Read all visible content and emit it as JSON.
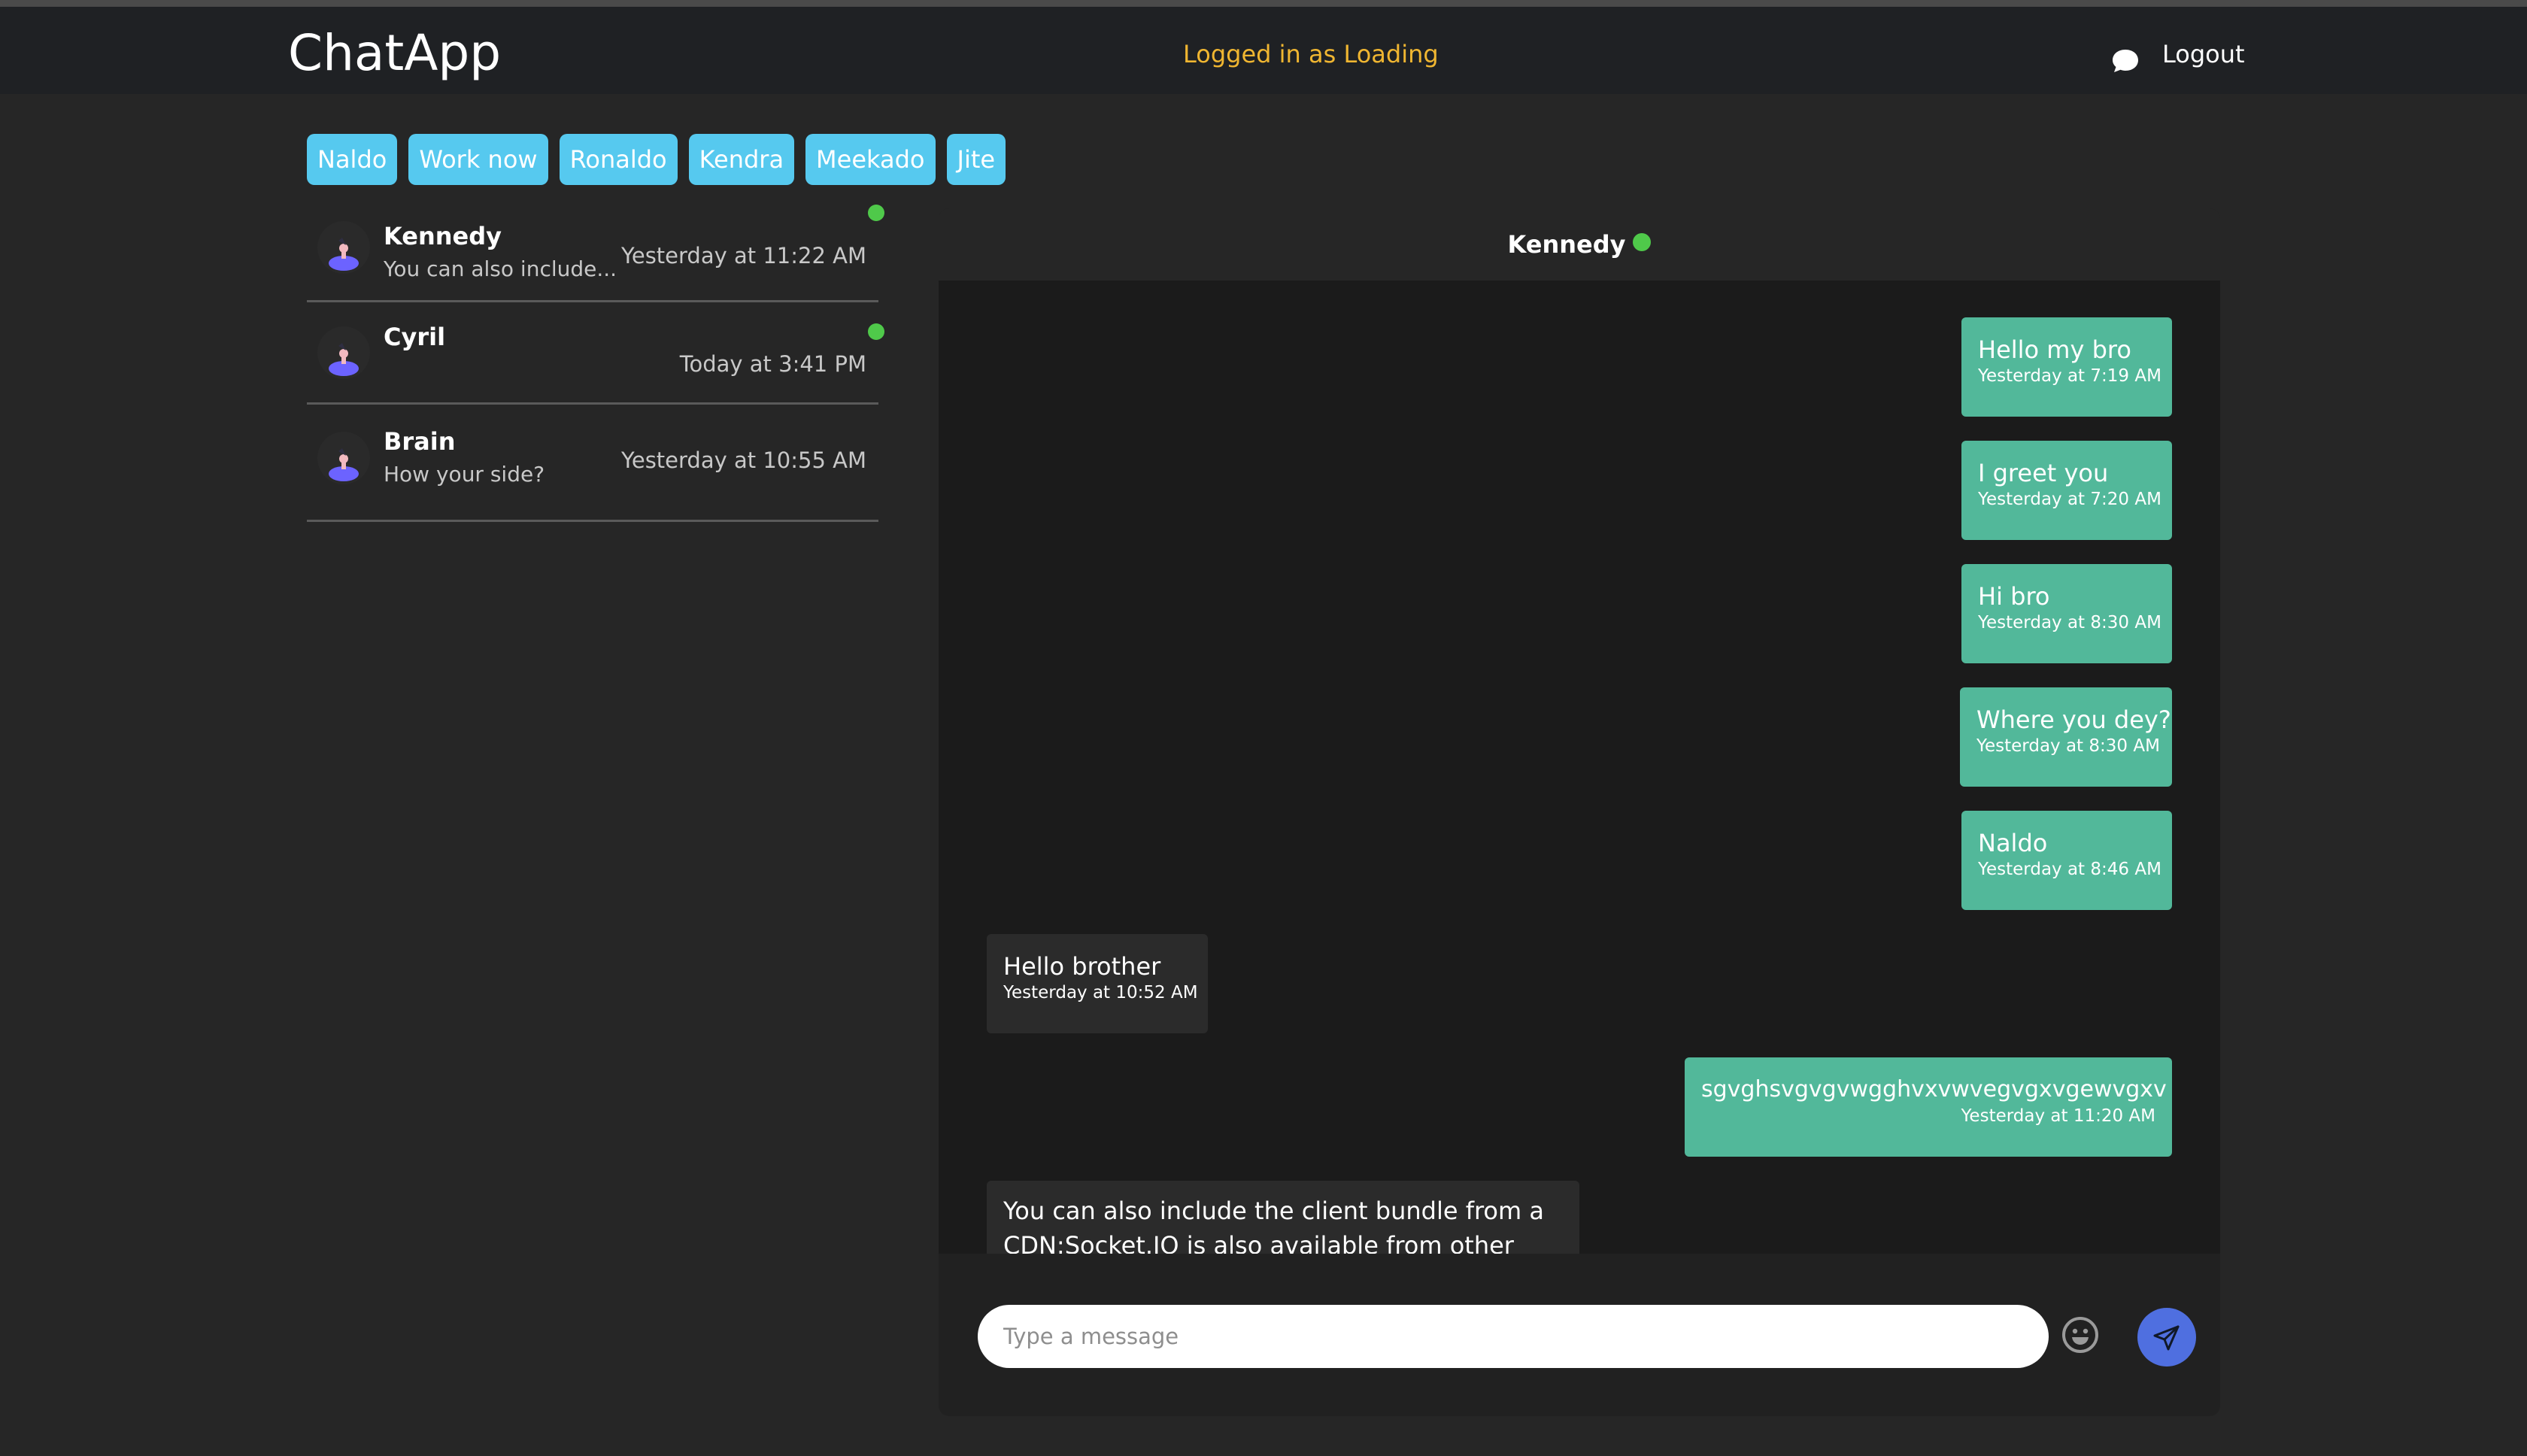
{
  "header": {
    "brand": "ChatApp",
    "status": "Logged in as Loading",
    "logout_label": "Logout",
    "chat_icon": "speech-bubble-icon"
  },
  "rooms": [
    "Naldo",
    "Work now",
    "Ronaldo",
    "Kendra",
    "Meekado",
    "Jite"
  ],
  "conversations": [
    {
      "name": "Kennedy",
      "preview": "You can also include...",
      "time": "Yesterday at 11:22 AM",
      "online": true
    },
    {
      "name": "Cyril",
      "preview": "",
      "time": "Today at 3:41 PM",
      "online": true
    },
    {
      "name": "Brain",
      "preview": "How your side?",
      "time": "Yesterday at 10:55 AM",
      "online": false
    }
  ],
  "chat": {
    "title": "Kennedy",
    "online": true,
    "messages": [
      {
        "text": "Hello my bro",
        "time": "Yesterday at 7:19 AM",
        "direction": "out"
      },
      {
        "text": "I greet you",
        "time": "Yesterday at 7:20 AM",
        "direction": "out"
      },
      {
        "text": "Hi bro",
        "time": "Yesterday at 8:30 AM",
        "direction": "out"
      },
      {
        "text": "Where you dey?",
        "time": "Yesterday at 8:30 AM",
        "direction": "out"
      },
      {
        "text": "Naldo",
        "time": "Yesterday at 8:46 AM",
        "direction": "out"
      },
      {
        "text": "Hello brother",
        "time": "Yesterday at 10:52 AM",
        "direction": "in"
      },
      {
        "text": "sgvghsvgvgvwgghvxvwvegvgxvgewvgxv",
        "time": "Yesterday at 11:20 AM",
        "direction": "out"
      },
      {
        "text": "You can also include the client bundle from a CDN:Socket.IO is also available from other",
        "time": "",
        "direction": "in"
      }
    ]
  },
  "composer": {
    "placeholder": "Type a message",
    "emoji_icon": "smiley-face-icon",
    "send_icon": "paper-plane-icon"
  },
  "colors": {
    "accent_chip": "#56c9ef",
    "outgoing_bubble": "#52b89a",
    "online": "#4fc94a",
    "status_text": "#f0b631",
    "send_button": "#4f6fe0"
  }
}
